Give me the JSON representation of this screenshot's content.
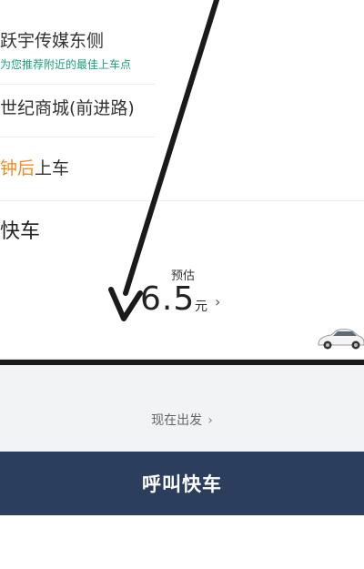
{
  "address": {
    "pickup_name": "跃宇传媒东侧",
    "pickup_hint": "为您推荐附近的最佳上车点",
    "destination_name": "世纪商城(前进路)"
  },
  "departure_time": {
    "highlight": "钟后",
    "suffix": "上车"
  },
  "car_type": {
    "label": "快车",
    "estimate_label": "预估",
    "price": "6.5",
    "unit": "元",
    "chevron": "›"
  },
  "depart_now": {
    "label": "现在出发",
    "chevron": "›"
  },
  "call_button": {
    "label": "呼叫快车"
  },
  "colors": {
    "accent_green": "#1aa17a",
    "accent_orange": "#f08a24",
    "button_navy": "#2b3e5e"
  },
  "icons": {
    "car": "car-icon",
    "arrow": "annotation-arrow"
  }
}
